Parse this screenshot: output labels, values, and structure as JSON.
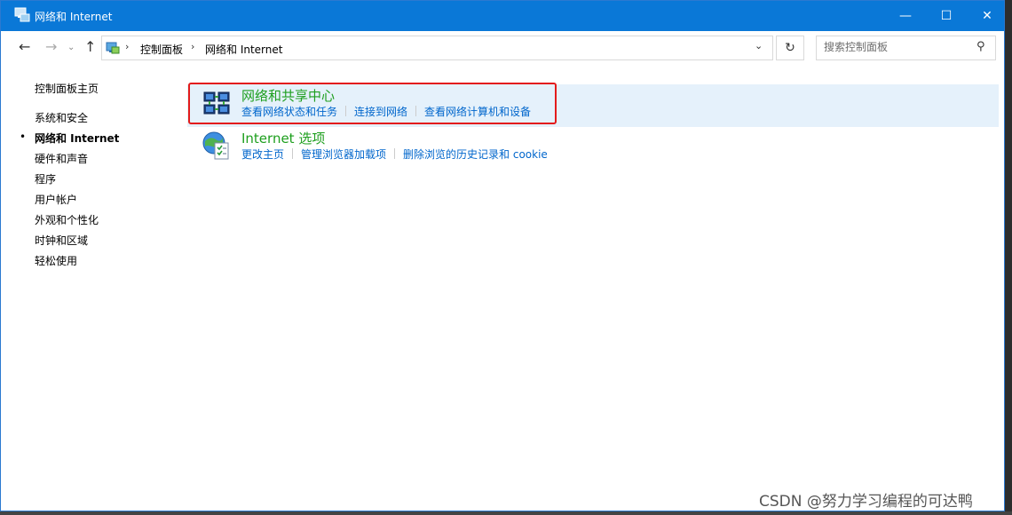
{
  "window": {
    "title": "网络和 Internet",
    "controls": {
      "minimize": "—",
      "maximize": "☐",
      "close": "✕"
    }
  },
  "nav": {
    "back": "←",
    "forward": "→",
    "recent": "⌄",
    "up": "↑",
    "breadcrumb": [
      "控制面板",
      "网络和 Internet"
    ],
    "separator": "›",
    "dropdown": "⌄",
    "refresh": "↻",
    "search_placeholder": "搜索控制面板",
    "search_icon": "⚲"
  },
  "sidebar": {
    "home": "控制面板主页",
    "items": [
      {
        "label": "系统和安全",
        "active": false
      },
      {
        "label": "网络和 Internet",
        "active": true
      },
      {
        "label": "硬件和声音",
        "active": false
      },
      {
        "label": "程序",
        "active": false
      },
      {
        "label": "用户帐户",
        "active": false
      },
      {
        "label": "外观和个性化",
        "active": false
      },
      {
        "label": "时钟和区域",
        "active": false
      },
      {
        "label": "轻松使用",
        "active": false
      }
    ],
    "bullet": "•"
  },
  "categories": [
    {
      "title": "网络和共享中心",
      "icon": "network-sharing-center-icon",
      "links": [
        "查看网络状态和任务",
        "连接到网络",
        "查看网络计算机和设备"
      ]
    },
    {
      "title": "Internet 选项",
      "icon": "internet-options-icon",
      "links": [
        "更改主页",
        "管理浏览器加载项",
        "删除浏览的历史记录和 cookie"
      ]
    }
  ],
  "watermark": "CSDN @努力学习编程的可达鸭",
  "colors": {
    "titlebar": "#0a78d7",
    "link": "#0066cc",
    "category_title": "#1e9f1e",
    "highlight": "#e31b1b",
    "hover": "#e5f1fb"
  }
}
